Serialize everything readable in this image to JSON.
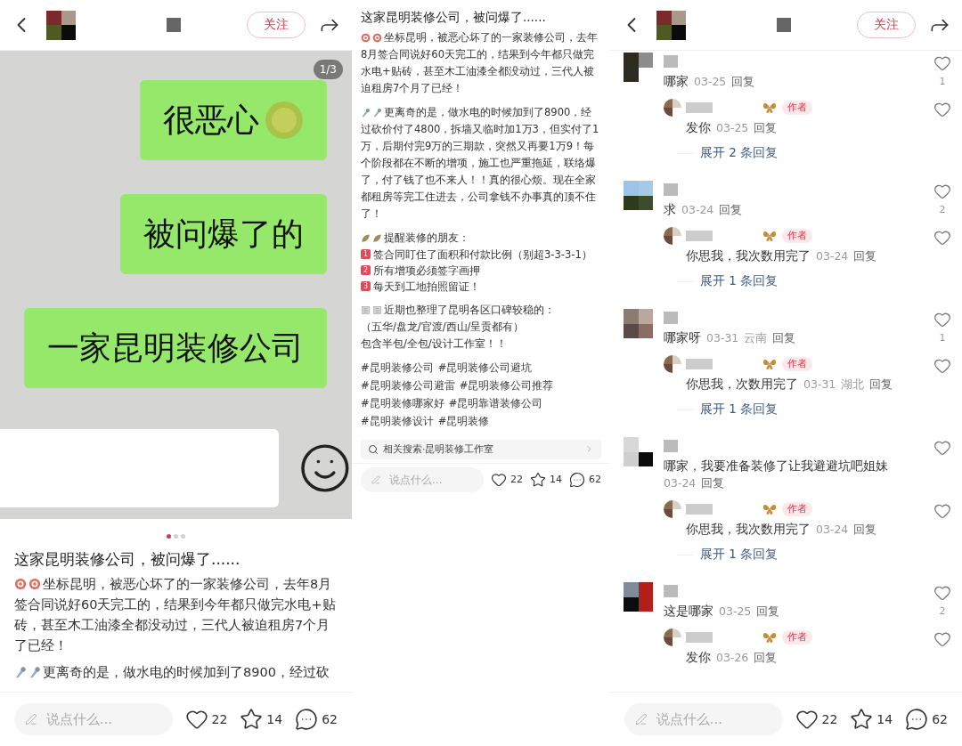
{
  "post_screen": {
    "header": {
      "follow_button": "关注"
    },
    "image": {
      "counter": "1/3",
      "messages": [
        {
          "text": "很恶心",
          "kind": "with_emoji"
        },
        {
          "text": "被问爆了的",
          "kind": "plain"
        },
        {
          "text": "一家昆明装修公司",
          "kind": "plain"
        }
      ]
    },
    "pager": [
      {
        "selected": true
      },
      {
        "selected": false
      },
      {
        "selected": false
      }
    ],
    "title": "这家昆明装修公司，被问爆了......",
    "paragraphs": [
      {
        "kind": "target",
        "text": "坐标昆明，被恶心坏了的一家装修公司，去年8月签合同说好60天完工的，结果到今年都只做完水电+贴砖，甚至木工油漆全都没动过，三代人被迫租房7个月了已经！"
      },
      {
        "kind": "pin",
        "text": "更离奇的是，做水电的时候加到了8900，经过砍"
      }
    ],
    "bottom_bar": {
      "placeholder": "说点什么...",
      "likes": "22",
      "stars": "14",
      "comments": "62"
    }
  },
  "text_screen": {
    "title": "这家昆明装修公司，被问爆了......",
    "blocks": [
      {
        "kind": "target_paragraph",
        "text": "坐标昆明，被恶心坏了的一家装修公司，去年8月签合同说好60天完工的，结果到今年都只做完水电+贴砖，甚至木工油漆全都没动过，三代人被迫租房7个月了已经！"
      },
      {
        "kind": "pin_paragraph",
        "text": "更离奇的是，做水电的时候加到了8900，经过砍价付了4800，拆墙又临时加1万3，但实付了1万，后期付完9万的三期款，突然又再要1万9！每个阶段都在不断的增项，施工也严重拖延，联络爆了，付了钱了也不来人！！真的很心烦。现在全家都租房等完工住进去，公司拿钱不办事真的顶不住了！"
      },
      {
        "kind": "leaf_list",
        "text": "提醒装修的朋友：",
        "items": [
          {
            "number": "1",
            "text": "签合同盯住了面积和付款比例（别超3-3-3-1）"
          },
          {
            "number": "2",
            "text": "所有增项必须签字画押"
          },
          {
            "number": "3",
            "text": "每天到工地拍照留证！"
          }
        ]
      },
      {
        "kind": "grid_lines",
        "lines": [
          "近期也整理了昆明各区口碑较稳的：",
          "（五华/盘龙/官渡/西山/呈贡都有）",
          "包含半包/全包/设计工作室！！"
        ]
      },
      {
        "kind": "hashtags",
        "tags": [
          "#昆明装修公司",
          "#昆明装修公司避坑",
          "#昆明装修公司避雷",
          "#昆明装修公司推荐",
          "#昆明装修哪家好",
          "#昆明靠谱装修公司",
          "#昆明装修设计",
          "#昆明装修"
        ]
      }
    ],
    "related_search": "相关搜索·昆明装修工作室",
    "bottom_bar": {
      "placeholder": "说点什么...",
      "likes": "22",
      "stars": "14",
      "comments": "62"
    }
  },
  "comments_screen": {
    "header": {
      "follow_button": "关注"
    },
    "comments": [
      {
        "text": "哪家",
        "time": "03-25",
        "reply": "回复",
        "likes": "1",
        "replies": [
          {
            "badge": "作者",
            "text": "发你",
            "time": "03-25",
            "reply": "回复"
          }
        ],
        "expand": "展开 2 条回复"
      },
      {
        "text": "求",
        "time": "03-24",
        "reply": "回复",
        "likes": "2",
        "replies": [
          {
            "badge": "作者",
            "text": "你思我，我次数用完了",
            "time": "03-24",
            "reply": "回复"
          }
        ],
        "expand": "展开 1 条回复"
      },
      {
        "text": "哪家呀",
        "time": "03-31",
        "location": "云南",
        "reply": "回复",
        "likes": "1",
        "replies": [
          {
            "badge": "作者",
            "text": "你思我，次数用完了",
            "time": "03-31",
            "location": "湖北",
            "reply": "回复"
          }
        ],
        "expand": "展开 1 条回复"
      },
      {
        "text": "哪家，我要准备装修了让我避避坑吧姐妹",
        "time": "03-24",
        "reply": "回复",
        "replies": [
          {
            "badge": "作者",
            "text": "你思我，我次数用完了",
            "time": "03-24",
            "reply": "回复"
          }
        ],
        "expand": "展开 1 条回复"
      },
      {
        "text": "这是哪家",
        "time": "03-25",
        "reply": "回复",
        "likes": "2",
        "replies": [
          {
            "badge": "作者",
            "text": "发你",
            "time": "03-26",
            "reply": "回复"
          }
        ]
      }
    ],
    "bottom_bar": {
      "placeholder": "说点什么...",
      "likes": "22",
      "stars": "14",
      "comments": "62"
    }
  }
}
